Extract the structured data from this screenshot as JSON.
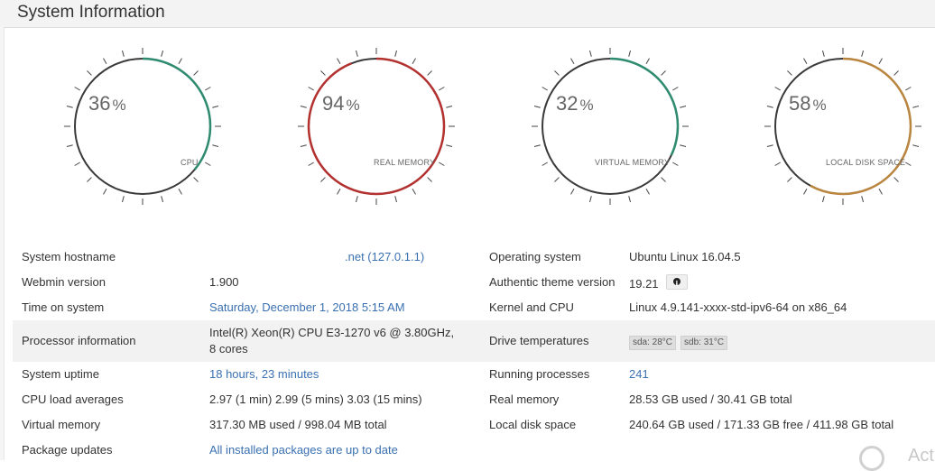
{
  "header": {
    "title": "System Information"
  },
  "gauges": [
    {
      "percent": "36",
      "symbol": "%",
      "label": "CPU",
      "value": 0.36,
      "color": "#2e8b6f"
    },
    {
      "percent": "94",
      "symbol": "%",
      "label": "REAL MEMORY",
      "value": 0.94,
      "color": "#b3312f"
    },
    {
      "percent": "32",
      "symbol": "%",
      "label": "VIRTUAL MEMORY",
      "value": 0.32,
      "color": "#2e8b6f"
    },
    {
      "percent": "58",
      "symbol": "%",
      "label": "LOCAL DISK SPACE",
      "value": 0.58,
      "color": "#b9853f"
    }
  ],
  "info": {
    "hostname": {
      "label": "System hostname",
      "value": ".net (127.0.1.1)"
    },
    "os": {
      "label": "Operating system",
      "value": "Ubuntu Linux 16.04.5"
    },
    "webmin": {
      "label": "Webmin version",
      "value": "1.900"
    },
    "theme": {
      "label": "Authentic theme version",
      "value": "19.21"
    },
    "time": {
      "label": "Time on system",
      "value": "Saturday, December 1, 2018 5:15 AM"
    },
    "kernel": {
      "label": "Kernel and CPU",
      "value": "Linux 4.9.141-xxxx-std-ipv6-64 on x86_64"
    },
    "processor": {
      "label": "Processor information",
      "value": "Intel(R) Xeon(R) CPU E3-1270 v6 @ 3.80GHz, 8 cores"
    },
    "drives": {
      "label": "Drive temperatures",
      "sda": "sda: 28°C",
      "sdb": "sdb: 31°C"
    },
    "uptime": {
      "label": "System uptime",
      "value": "18 hours, 23 minutes"
    },
    "processes": {
      "label": "Running processes",
      "value": "241"
    },
    "load": {
      "label": "CPU load averages",
      "value": "2.97 (1 min) 2.99 (5 mins) 3.03 (15 mins)"
    },
    "realmem": {
      "label": "Real memory",
      "value": "28.53 GB used / 30.41 GB total"
    },
    "virtmem": {
      "label": "Virtual memory",
      "value": "317.30 MB used / 998.04 MB total"
    },
    "disk": {
      "label": "Local disk space",
      "value": "240.64 GB used / 171.33 GB free / 411.98 GB total"
    },
    "packages": {
      "label": "Package updates",
      "value": "All installed packages are up to date"
    }
  },
  "corner": {
    "text": "Act"
  }
}
